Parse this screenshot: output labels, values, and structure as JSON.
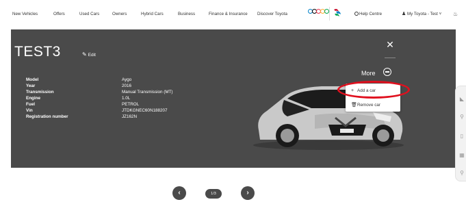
{
  "nav": {
    "items": [
      "New Vehicles",
      "Offers",
      "Used Cars",
      "Owners",
      "Hybrid Cars",
      "Business",
      "Finance & Insurance",
      "Discover Toyota"
    ],
    "help": "Help Centre",
    "account": "My Toyota - Test",
    "colors": {
      "rings": [
        "#0081c8",
        "#000000",
        "#ee334e",
        "#fcb131",
        "#00a651"
      ]
    }
  },
  "vehicle": {
    "title": "TEST3",
    "edit_label": "Edit",
    "more_label": "More",
    "specs": [
      {
        "label": "Model",
        "value": "Aygo"
      },
      {
        "label": "Year",
        "value": "2016"
      },
      {
        "label": "Transmission",
        "value": "Manual Transmission (MT)"
      },
      {
        "label": "Engine",
        "value": "1.0L"
      },
      {
        "label": "Fuel",
        "value": "PETROL"
      },
      {
        "label": "Vin",
        "value": "JTDKGNEC60N188207"
      },
      {
        "label": "Registration number",
        "value": "JZ162N"
      }
    ]
  },
  "dropdown": {
    "items": [
      {
        "label": "Add a car",
        "icon": "plus-icon"
      },
      {
        "label": "Remove car",
        "icon": "trash-icon"
      }
    ]
  },
  "pagination": {
    "counter": "1/3"
  },
  "side_toolbar": {
    "icons": [
      "car-icon",
      "location-pin-icon",
      "document-icon",
      "calendar-icon",
      "wrench-icon"
    ]
  }
}
